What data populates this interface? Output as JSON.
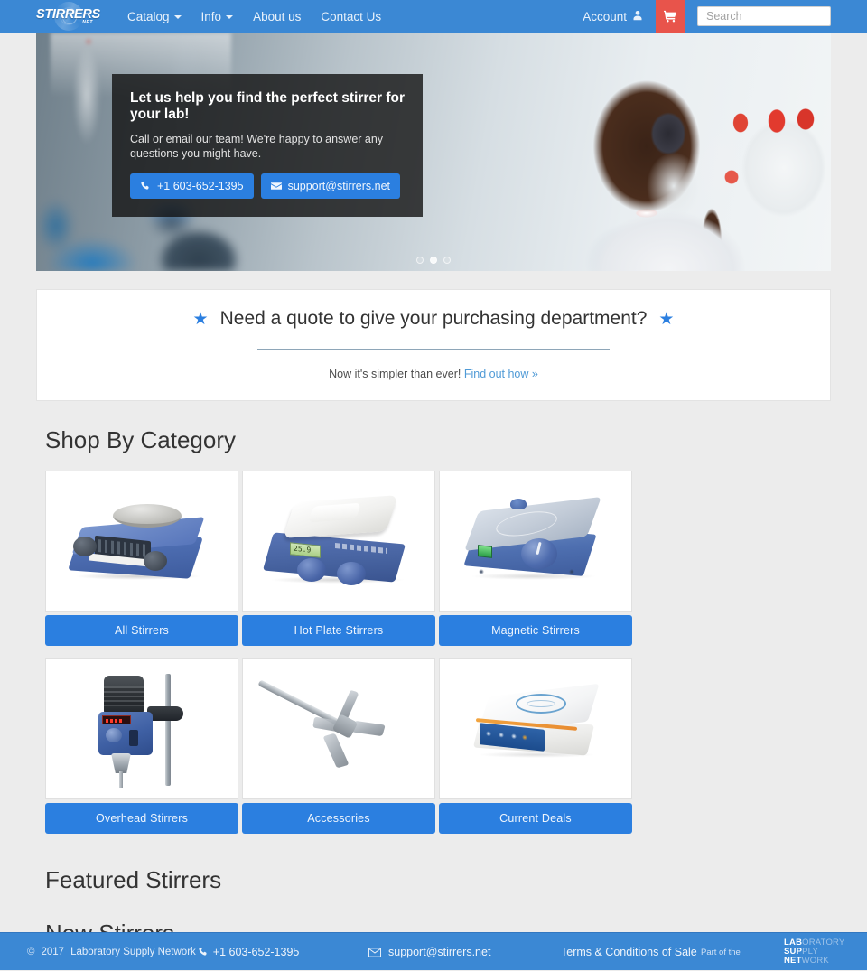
{
  "brand": {
    "wordmark": "STIRRERS",
    "suffix": ".NET"
  },
  "nav": {
    "items": [
      {
        "label": "Catalog",
        "has_caret": true
      },
      {
        "label": "Info",
        "has_caret": true
      },
      {
        "label": "About us",
        "has_caret": false
      },
      {
        "label": "Contact Us",
        "has_caret": false
      }
    ],
    "account_label": "Account",
    "cart_icon": "shopping-cart-icon",
    "search_placeholder": "Search",
    "search_value": ""
  },
  "hero": {
    "heading": "Let us help you find the perfect stirrer for your lab!",
    "body": "Call or email our team! We're happy to answer any questions you might have.",
    "phone_label": "+1 603-652-1395",
    "email_label": "support@stirrers.net",
    "slides": 3,
    "active_slide": 2
  },
  "quote": {
    "title": "Need a quote to give your purchasing department?",
    "star_left": "★",
    "star_right": "★",
    "sub_text": "Now it's simpler than ever!",
    "sub_link": "Find out how »"
  },
  "categories": {
    "heading": "Shop By Category",
    "items": [
      {
        "label": "All Stirrers",
        "art": "p1"
      },
      {
        "label": "Hot Plate Stirrers",
        "art": "p2"
      },
      {
        "label": "Magnetic Stirrers",
        "art": "p3"
      },
      {
        "label": "Overhead Stirrers",
        "art": "p4"
      },
      {
        "label": "Accessories",
        "art": "p5"
      },
      {
        "label": "Current Deals",
        "art": "p6"
      }
    ]
  },
  "sections": {
    "featured_heading": "Featured Stirrers",
    "new_heading": "New Stirrers"
  },
  "footer": {
    "copyright_mark": "©",
    "year": "2017",
    "company": "Laboratory Supply Network",
    "phone": "+1 603-652-1395",
    "email": "support@stirrers.net",
    "terms": "Terms & Conditions of Sale",
    "part_of": "Part of the",
    "lsn": {
      "line1_bold": "LAB",
      "line1_rest": "ORATORY",
      "line2_bold": "SUP",
      "line2_rest": "PLY",
      "line3_bold": "NET",
      "line3_rest": "WORK"
    }
  },
  "colors": {
    "brand_blue": "#3b88d4",
    "button_blue": "#2b7fe0",
    "cart_red": "#e8544b",
    "page_bg": "#ececec",
    "link_blue": "#4f9ad6"
  }
}
